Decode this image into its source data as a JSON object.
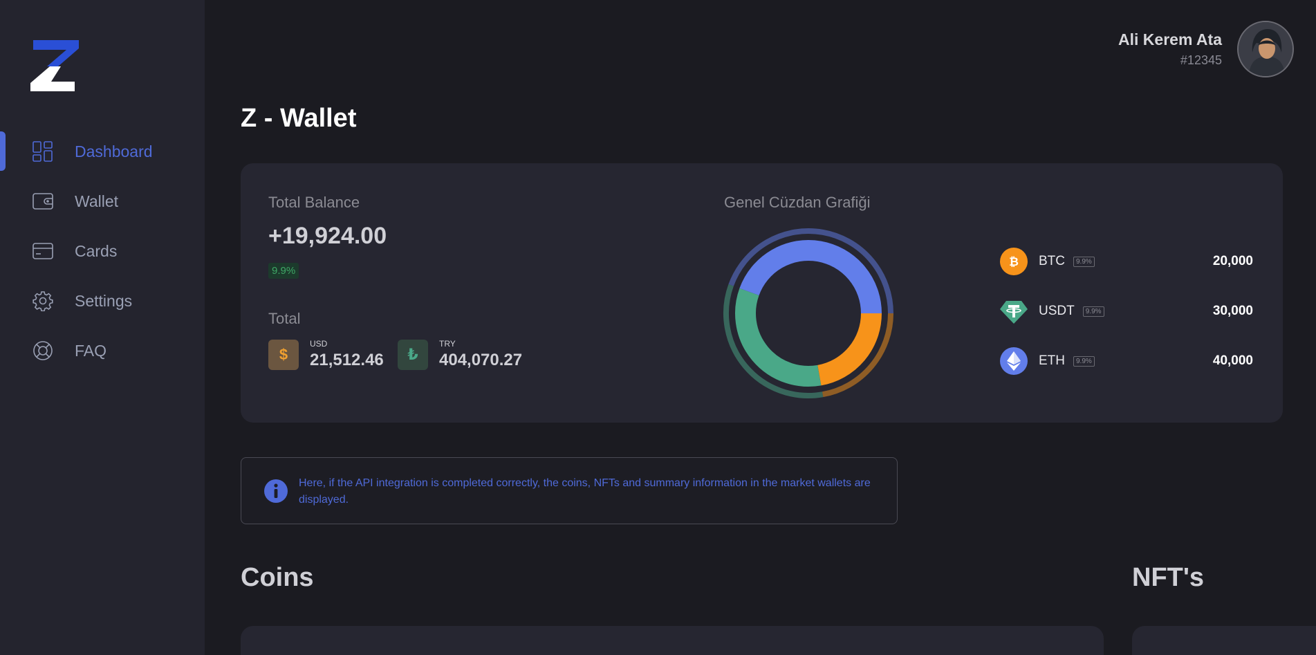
{
  "sidebar": {
    "items": [
      {
        "label": "Dashboard",
        "icon": "dashboard-icon",
        "active": true
      },
      {
        "label": "Wallet",
        "icon": "wallet-icon"
      },
      {
        "label": "Cards",
        "icon": "card-icon"
      },
      {
        "label": "Settings",
        "icon": "gear-icon"
      },
      {
        "label": "FAQ",
        "icon": "lifebuoy-icon"
      }
    ]
  },
  "user": {
    "name": "Ali Kerem Ata",
    "id": "#12345"
  },
  "page": {
    "title": "Z - Wallet"
  },
  "balance": {
    "total_label": "Total Balance",
    "value": "+19,924.00",
    "pct": "9.9%",
    "total_section_label": "Total",
    "currencies": [
      {
        "code": "USD",
        "symbol": "$",
        "value": "21,512.46"
      },
      {
        "code": "TRY",
        "symbol": "₺",
        "value": "404,070.27"
      }
    ]
  },
  "chart": {
    "title": "Genel Cüzdan Grafiği"
  },
  "chart_data": {
    "type": "pie",
    "categories": [
      "BTC",
      "USDT",
      "ETH"
    ],
    "values": [
      20000,
      30000,
      40000
    ],
    "colors": [
      "#f7931a",
      "#4aa888",
      "#627eea"
    ]
  },
  "coins": [
    {
      "name": "BTC",
      "pct": "9.9%",
      "value": "20,000",
      "color": "#f7931a",
      "icon": "bitcoin-icon"
    },
    {
      "name": "USDT",
      "pct": "9.9%",
      "value": "30,000",
      "color": "#4aa888",
      "icon": "tether-icon"
    },
    {
      "name": "ETH",
      "pct": "9.9%",
      "value": "40,000",
      "color": "#627eea",
      "icon": "ethereum-icon"
    }
  ],
  "info": {
    "text": "Here, if the API integration is completed correctly, the coins, NFTs and summary information in the market wallets are displayed."
  },
  "sections": {
    "coins": "Coins",
    "nfts": "NFT's"
  }
}
